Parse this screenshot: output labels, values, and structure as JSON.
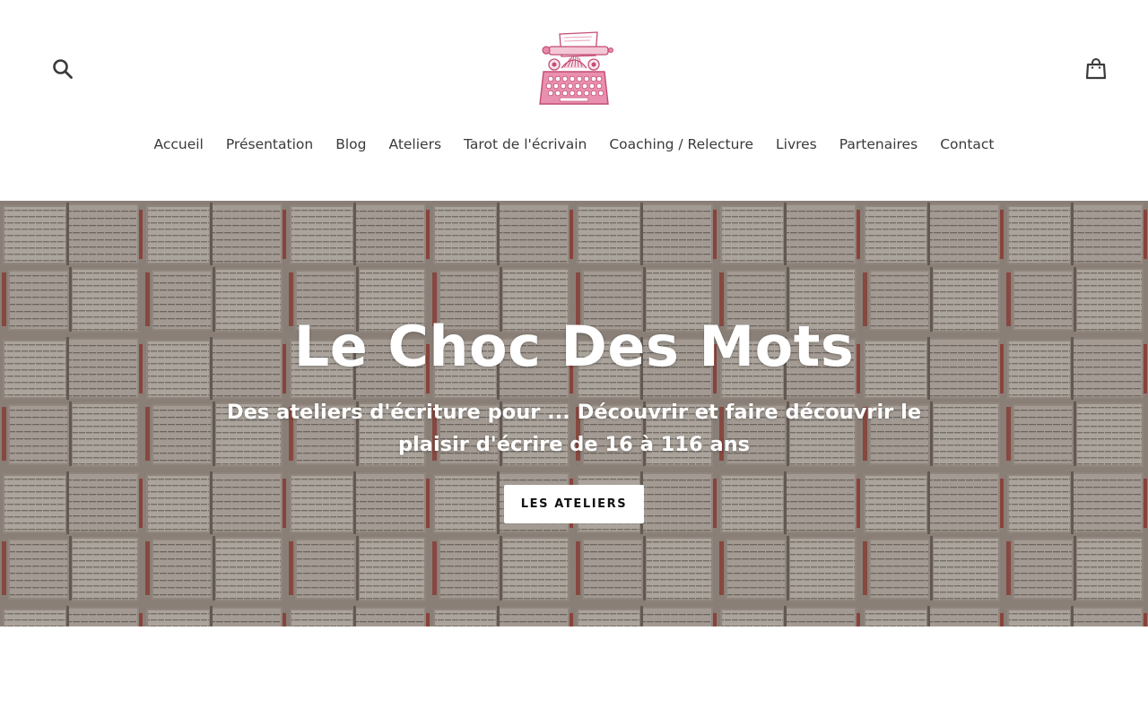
{
  "header": {
    "nav": [
      {
        "label": "Accueil"
      },
      {
        "label": "Présentation"
      },
      {
        "label": "Blog"
      },
      {
        "label": "Ateliers"
      },
      {
        "label": "Tarot de l'écrivain"
      },
      {
        "label": "Coaching / Relecture"
      },
      {
        "label": "Livres"
      },
      {
        "label": "Partenaires"
      },
      {
        "label": "Contact"
      }
    ],
    "logo_icon": "typewriter-logo",
    "search_icon": "search-icon",
    "cart_icon": "cart-icon"
  },
  "hero": {
    "title": "Le Choc Des Mots",
    "subtitle": "Des ateliers d'écriture pour ... Découvrir et faire découvrir le plaisir d'écrire de 16 à 116 ans",
    "button_label": "LES ATELIERS",
    "background": "open books image"
  },
  "colors": {
    "text": "#3a3a3a",
    "logo_pink": "#d0587e",
    "hero_text": "#ffffff",
    "button_bg": "#ffffff",
    "button_text": "#111111"
  }
}
